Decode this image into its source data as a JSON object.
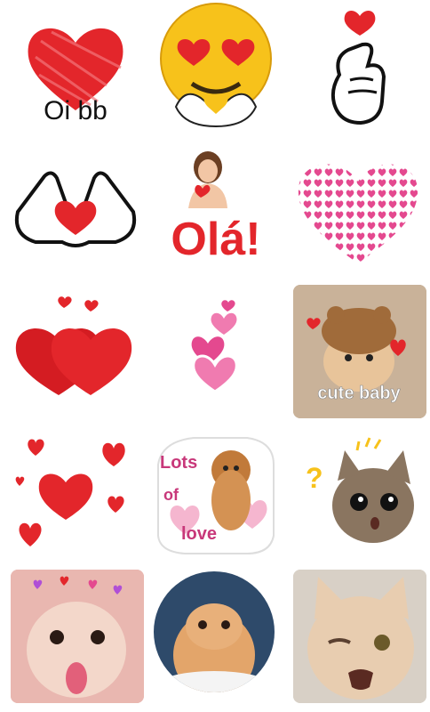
{
  "sticker_grid": {
    "stickers": [
      {
        "name": "scribble-heart-oi-bb",
        "text": "Oi bb"
      },
      {
        "name": "heart-eyes-emoji",
        "text": ""
      },
      {
        "name": "finger-heart",
        "text": ""
      },
      {
        "name": "hand-heart-gesture",
        "text": ""
      },
      {
        "name": "ola-woman",
        "text": "Olá!"
      },
      {
        "name": "heart-of-hearts",
        "text": ""
      },
      {
        "name": "two-red-hearts",
        "text": ""
      },
      {
        "name": "pink-heart-stack",
        "text": ""
      },
      {
        "name": "cute-baby-cat",
        "text": "cute baby"
      },
      {
        "name": "scattered-red-hearts",
        "text": ""
      },
      {
        "name": "lots-of-love-puppy",
        "text_line1": "Lots",
        "text_line2": "of",
        "text_line3": "love"
      },
      {
        "name": "surprised-cat",
        "text": "?"
      },
      {
        "name": "cat-with-hearts",
        "text": ""
      },
      {
        "name": "fluffy-kitten-circle",
        "text": ""
      },
      {
        "name": "winking-cat",
        "text": ""
      }
    ]
  },
  "colors": {
    "heart_red": "#e3262b",
    "heart_pink": "#e4498f",
    "emoji_yellow": "#f7c21b",
    "text_black": "#111111"
  }
}
